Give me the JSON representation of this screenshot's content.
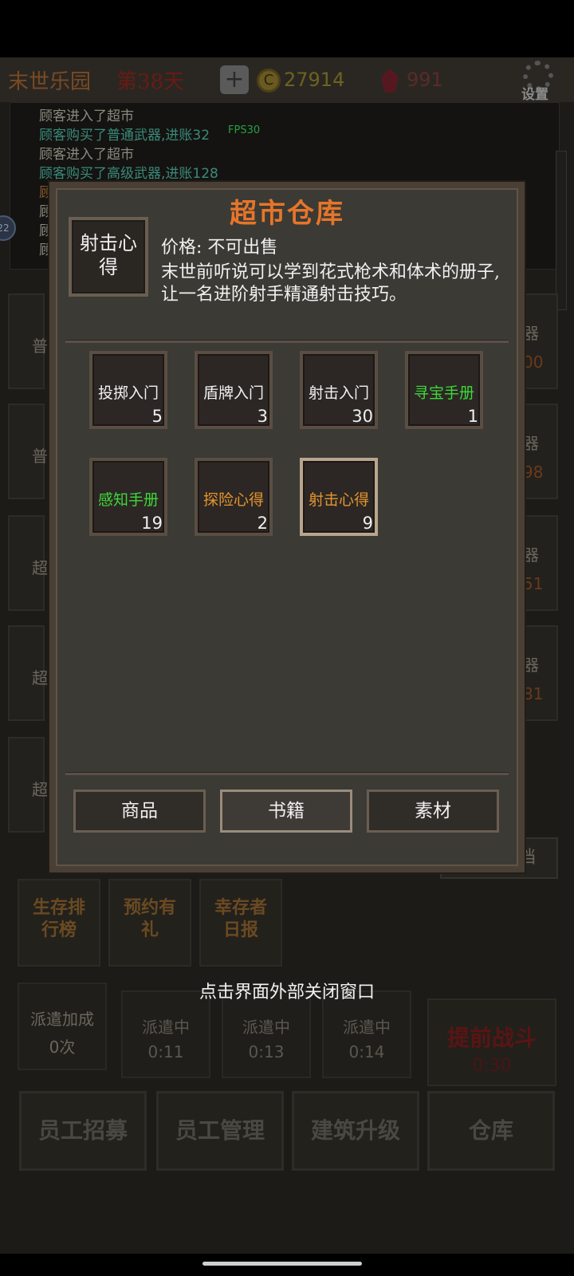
{
  "header": {
    "title": "末世乐园",
    "day": "第38天",
    "plus_icon": "plus-icon",
    "coins": "27914",
    "gems": "991",
    "settings_label": "设置"
  },
  "log": {
    "lines": [
      {
        "text": "顾客进入了超市",
        "color": "#8a8a7e"
      },
      {
        "text": "顾客购买了普通武器,进账32",
        "color": "#3a8a7a"
      },
      {
        "text": "顾客进入了超市",
        "color": "#8a8a7e"
      },
      {
        "text": "顾客购买了高级武器,进账128",
        "color": "#3a8a7a"
      },
      {
        "text": "顾",
        "color": "#8a5a2a"
      },
      {
        "text": "顾",
        "color": "#8a8a7e"
      },
      {
        "text": "顾",
        "color": "#8a8a7e"
      },
      {
        "text": "顾",
        "color": "#8a8a7e"
      }
    ],
    "fps": "FPS30",
    "badge": "22"
  },
  "side_cards_left": [
    "普",
    "普",
    "超",
    "超",
    "超"
  ],
  "side_cards_right": [
    {
      "a": "器",
      "b": "00"
    },
    {
      "a": "器",
      "b": "98"
    },
    {
      "a": "器",
      "b": "51"
    },
    {
      "a": "器",
      "b": "81"
    }
  ],
  "ghost_tab": "档",
  "quick_buttons": [
    {
      "label": "生存排行榜"
    },
    {
      "label": "预约有礼"
    },
    {
      "label": "幸存者日报"
    }
  ],
  "close_hint": "点击界面外部关闭窗口",
  "dispatch": {
    "bonus_label": "派遣加成",
    "bonus_value": "0次",
    "slots": [
      {
        "label": "派遣中",
        "time": "0:11"
      },
      {
        "label": "派遣中",
        "time": "0:13"
      },
      {
        "label": "派遣中",
        "time": "0:14"
      }
    ],
    "early_fight_label": "提前战斗",
    "early_fight_time": "0:30"
  },
  "bottom_nav": [
    "员工招募",
    "员工管理",
    "建筑升级",
    "仓库"
  ],
  "modal": {
    "title": "超市仓库",
    "selected": {
      "name": "射击心得",
      "price": "价格: 不可出售",
      "description": "末世前听说可以学到花式枪术和体术的册子, 让一名进阶射手精通射击技巧。"
    },
    "items": [
      {
        "name": "投掷入门",
        "qty": "5",
        "color": "#f0f0f0"
      },
      {
        "name": "盾牌入门",
        "qty": "3",
        "color": "#f0f0f0"
      },
      {
        "name": "射击入门",
        "qty": "30",
        "color": "#f0f0f0"
      },
      {
        "name": "寻宝手册",
        "qty": "1",
        "color": "#3ed83a"
      },
      {
        "name": "感知手册",
        "qty": "19",
        "color": "#3ed83a"
      },
      {
        "name": "探险心得",
        "qty": "2",
        "color": "#e4952e"
      },
      {
        "name": "射击心得",
        "qty": "9",
        "color": "#e4952e"
      }
    ],
    "tabs": [
      "商品",
      "书籍",
      "素材"
    ],
    "active_tab": "书籍"
  }
}
